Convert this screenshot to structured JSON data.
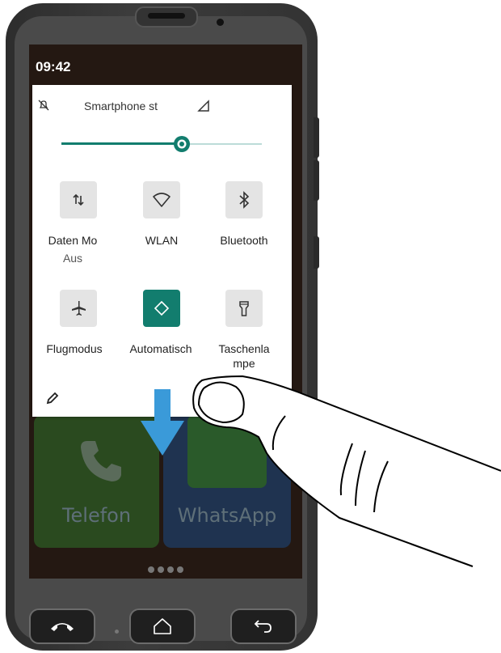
{
  "status_bar": {
    "time": "09:42"
  },
  "quick_settings": {
    "header_label": "Smartphone st",
    "brightness_level": 0.6,
    "tiles": [
      {
        "label": "Daten   Mo",
        "sublabel": "Aus",
        "icon": "mobile-data-icon",
        "active": false
      },
      {
        "label": "WLAN",
        "sublabel": "",
        "icon": "wifi-icon",
        "active": false
      },
      {
        "label": "Bluetooth",
        "sublabel": "",
        "icon": "bluetooth-icon",
        "active": false
      },
      {
        "label": "Flugmodus",
        "sublabel": "",
        "icon": "airplane-icon",
        "active": false
      },
      {
        "label": "Automatisch",
        "sublabel": "",
        "icon": "auto-rotate-icon",
        "active": true
      },
      {
        "label": "Taschenla",
        "sublabel": "mpe",
        "icon": "flashlight-icon",
        "active": false
      }
    ]
  },
  "home": {
    "apps": [
      {
        "label": "Telefon",
        "color": "#2a4a1f"
      },
      {
        "label": "WhatsApp",
        "color": "#1f3350"
      }
    ]
  },
  "colors": {
    "accent": "#127d6e",
    "swipe_arrow": "#3a9ad9"
  }
}
